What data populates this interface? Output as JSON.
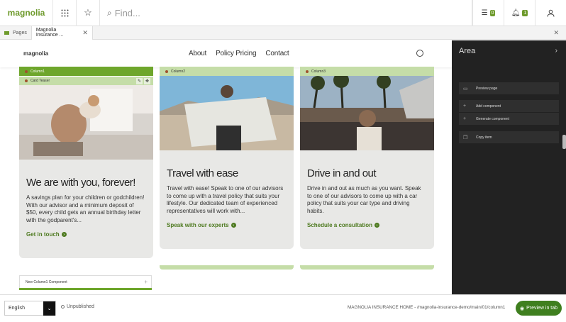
{
  "topbar": {
    "logo": "magnolia",
    "search_placeholder": "Find...",
    "tasks_count": "0",
    "notifications_count": "1"
  },
  "tabs": [
    {
      "label": "Pages"
    },
    {
      "label": "Magnolia Insurance ..."
    }
  ],
  "site": {
    "logo": "magnolia",
    "nav": [
      "About",
      "Policy Pricing",
      "Contact"
    ]
  },
  "columns": [
    {
      "bar": "Column1",
      "teaser_bar": "Card Teaser",
      "title": "We are with you, forever!",
      "text": "A savings plan for your children or godchildren! With our advisor and a minimum deposit of $50, every child gets an annual birthday letter with the godparent's...",
      "cta": "Get in touch"
    },
    {
      "bar": "Column2",
      "title": "Travel with ease",
      "text": "Travel with ease! Speak to one of our advisors to come up with a travel policy that suits your lifestyle. Our dedicated team of experienced representatives will work with...",
      "cta": "Speak with our experts"
    },
    {
      "bar": "Column3",
      "title": "Drive in and out",
      "text": "Drive in and out as much as you want. Speak to one of our advisors to come up with a car policy that suits your car type and driving habits.",
      "cta": "Schedule a consultation"
    }
  ],
  "new_component": "New Column1 Component",
  "panel": {
    "title": "Area",
    "items": [
      "Preview page",
      "Add component",
      "Generate component",
      "Copy item"
    ]
  },
  "bottombar": {
    "language": "English",
    "status": "Unpublished",
    "path": "MAGNOLIA INSURANCE HOME - /magnolia-insurance-demo/main/01/column1",
    "preview_button": "Preview in tab"
  }
}
